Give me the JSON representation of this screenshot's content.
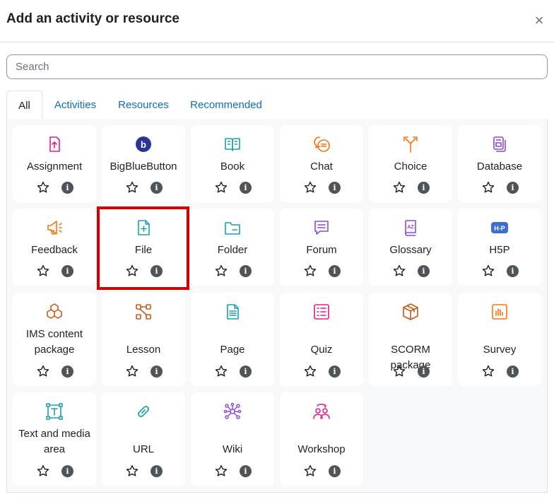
{
  "modal": {
    "title": "Add an activity or resource",
    "close_label": "×"
  },
  "search": {
    "placeholder": "Search"
  },
  "tabs": [
    {
      "label": "All"
    },
    {
      "label": "Activities"
    },
    {
      "label": "Resources"
    },
    {
      "label": "Recommended"
    }
  ],
  "modules": [
    {
      "name": "Assignment",
      "icon": "assignment-icon",
      "color": "#e31c8d"
    },
    {
      "name": "BigBlueButton",
      "icon": "bigbluebutton-icon",
      "color": "#283593"
    },
    {
      "name": "Book",
      "icon": "book-icon",
      "color": "#1ba0b4"
    },
    {
      "name": "Chat",
      "icon": "chat-icon",
      "color": "#f7740f"
    },
    {
      "name": "Choice",
      "icon": "choice-icon",
      "color": "#f7740f"
    },
    {
      "name": "Database",
      "icon": "database-icon",
      "color": "#8a4bd8"
    },
    {
      "name": "Feedback",
      "icon": "feedback-icon",
      "color": "#f7740f"
    },
    {
      "name": "File",
      "icon": "file-icon",
      "color": "#1ba0b4"
    },
    {
      "name": "Folder",
      "icon": "folder-icon",
      "color": "#1ba0b4"
    },
    {
      "name": "Forum",
      "icon": "forum-icon",
      "color": "#8a4bd8"
    },
    {
      "name": "Glossary",
      "icon": "glossary-icon",
      "color": "#8a4bd8"
    },
    {
      "name": "H5P",
      "icon": "h5p-icon",
      "color": "#3a6fd1"
    },
    {
      "name": "IMS content package",
      "icon": "ims-package-icon",
      "color": "#c55b17"
    },
    {
      "name": "Lesson",
      "icon": "lesson-icon",
      "color": "#c55b17"
    },
    {
      "name": "Page",
      "icon": "page-icon",
      "color": "#1ba0b4"
    },
    {
      "name": "Quiz",
      "icon": "quiz-icon",
      "color": "#e31c8d"
    },
    {
      "name": "SCORM package",
      "icon": "scorm-icon",
      "color": "#c55b17"
    },
    {
      "name": "Survey",
      "icon": "survey-icon",
      "color": "#f7740f"
    },
    {
      "name": "Text and media area",
      "icon": "text-media-icon",
      "color": "#1ba0b4"
    },
    {
      "name": "URL",
      "icon": "url-icon",
      "color": "#1ba0b4"
    },
    {
      "name": "Wiki",
      "icon": "wiki-icon",
      "color": "#8a4bd8"
    },
    {
      "name": "Workshop",
      "icon": "workshop-icon",
      "color": "#e31c8d"
    }
  ],
  "info_glyph": "i"
}
